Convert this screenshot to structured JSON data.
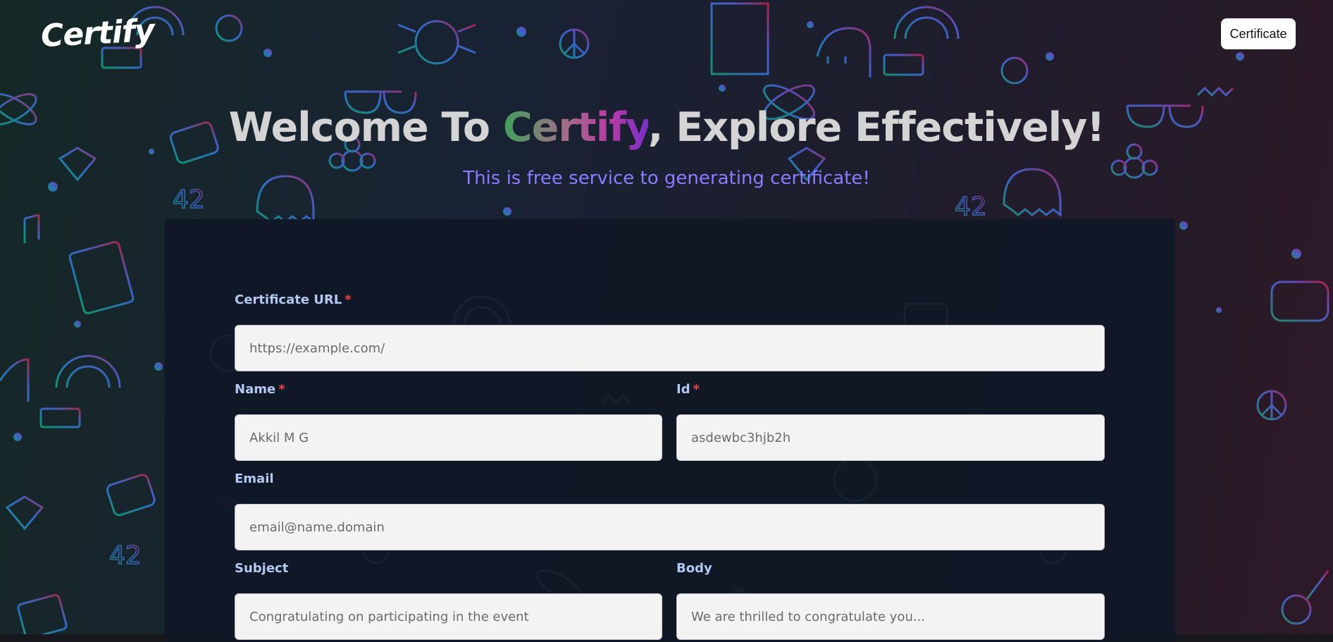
{
  "header": {
    "logo_text": "Certify",
    "certificate_button": "Certificate"
  },
  "hero": {
    "title_prefix": "Welcome To ",
    "title_brand": "Certify",
    "title_suffix": ", Explore Effectively!",
    "subtitle": "This is free service to generating certificate!"
  },
  "form": {
    "certificate_url": {
      "label": "Certificate URL",
      "required": "*",
      "placeholder": "https://example.com/"
    },
    "name": {
      "label": "Name",
      "required": "*",
      "placeholder": "Akkil M G"
    },
    "id": {
      "label": "Id",
      "required": "*",
      "placeholder": "asdewbc3hjb2h"
    },
    "email": {
      "label": "Email",
      "placeholder": "email@name.domain"
    },
    "subject": {
      "label": "Subject",
      "placeholder": "Congratulating on participating in the event"
    },
    "body": {
      "label": "Body",
      "placeholder": "We are thrilled to congratulate you..."
    }
  },
  "colors": {
    "page_bg": "#16181d",
    "panel_bg": "#111827",
    "label": "#b3c8f2",
    "required": "#ef4444",
    "subtitle": "#8b7bff",
    "doodle_left": "#10b981",
    "doodle_mid": "#3b82f6",
    "doodle_right": "#db2777"
  }
}
